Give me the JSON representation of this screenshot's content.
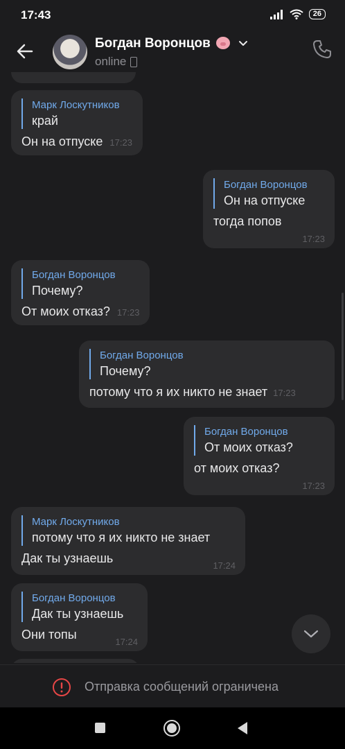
{
  "status_bar": {
    "time": "17:43",
    "battery": "26"
  },
  "header": {
    "contact_name": "Богдан Воронцов",
    "status": "online"
  },
  "messages": [
    {
      "side": "in",
      "quote_author": "Марк Лоскутников",
      "quote_text": "край",
      "text": "Он на отпуске",
      "time": "17:23"
    },
    {
      "side": "out",
      "quote_author": "Богдан Воронцов",
      "quote_text": "Он на отпуске",
      "text": "тогда попов",
      "time": "17:23"
    },
    {
      "side": "in",
      "quote_author": "Богдан Воронцов",
      "quote_text": "Почему?",
      "text": "От моих отказ?",
      "time": "17:23"
    },
    {
      "side": "out",
      "quote_author": "Богдан Воронцов",
      "quote_text": "Почему?",
      "text": "потому что я их никто не знает",
      "time": "17:23"
    },
    {
      "side": "out",
      "quote_author": "Богдан Воронцов",
      "quote_text": "От моих отказ?",
      "text": "от моих отказ?",
      "time": "17:23"
    },
    {
      "side": "in",
      "quote_author": "Марк Лоскутников",
      "quote_text": "потому что я их никто не знает",
      "text": "Дак ты узнаешь",
      "time": "17:24"
    },
    {
      "side": "in",
      "quote_author": "Богдан Воронцов",
      "quote_text": "Дак ты узнаешь",
      "text": "Они топы",
      "time": "17:24"
    }
  ],
  "footer": {
    "restriction_text": "Отправка сообщений ограничена"
  },
  "colors": {
    "accent": "#71aaeb",
    "bubble": "#2c2c2e",
    "background": "#1c1c1e",
    "warning": "#e64646"
  },
  "icons": [
    "back-arrow-icon",
    "pig-emoji-icon",
    "chevron-down-icon",
    "phone-icon",
    "call-icon",
    "chevron-down-icon",
    "warning-icon"
  ]
}
